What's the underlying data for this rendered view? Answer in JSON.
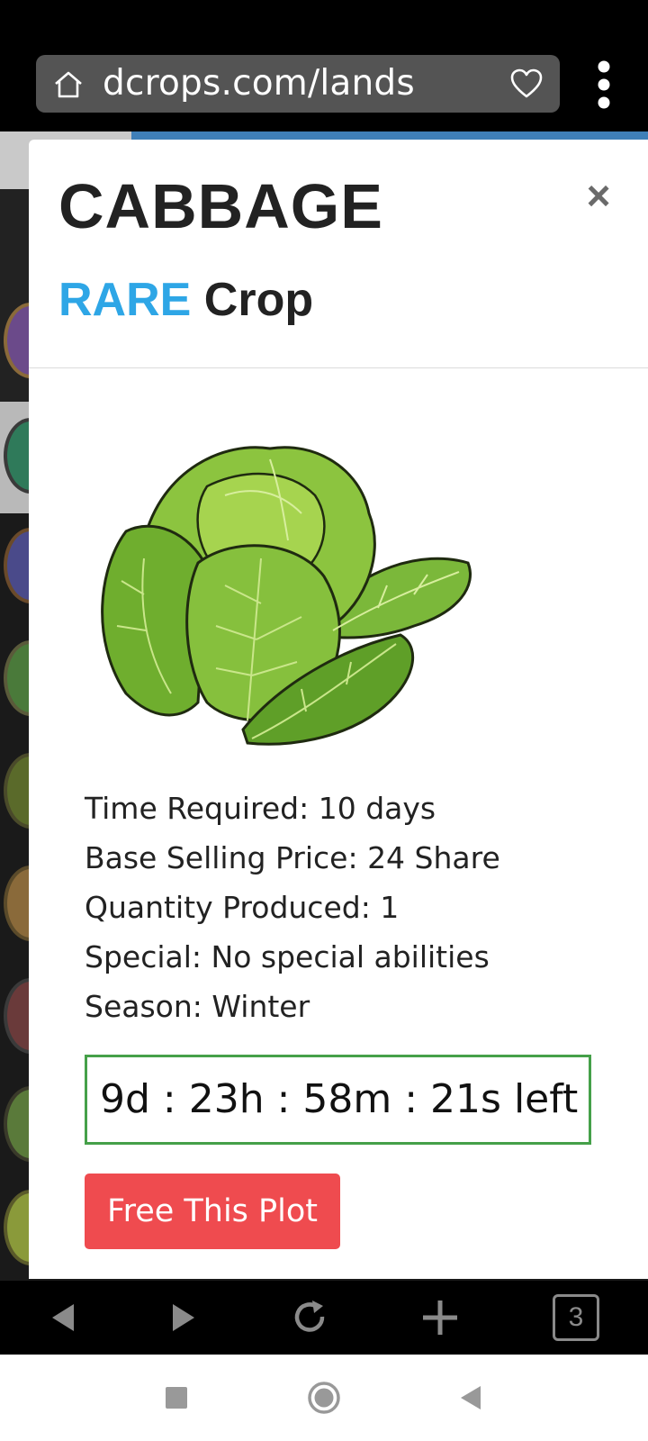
{
  "browser": {
    "url": "dcrops.com/lands",
    "tab_count": "3",
    "icons": [
      "home-icon",
      "heart-icon",
      "overflow-menu-icon",
      "back-icon",
      "forward-icon",
      "reload-icon",
      "new-tab-icon"
    ]
  },
  "modal": {
    "title": "CABBAGE",
    "close_label": "×",
    "rarity": "RARE",
    "crop_word": "Crop",
    "details": [
      "Time Required: 10 days",
      "Base Selling Price: 24 Share",
      "Quantity Produced: 1",
      "Special: No special abilities",
      "Season: Winter"
    ],
    "timer": "9d : 23h : 58m : 21s left",
    "free_button": "Free This Plot"
  },
  "colors": {
    "rarity": "#2ea6e6",
    "timer_border": "#45a049",
    "free_button_bg": "#ef4b4f"
  },
  "system_nav": {
    "icons": [
      "recents-square-icon",
      "home-circle-icon",
      "back-triangle-icon"
    ]
  }
}
